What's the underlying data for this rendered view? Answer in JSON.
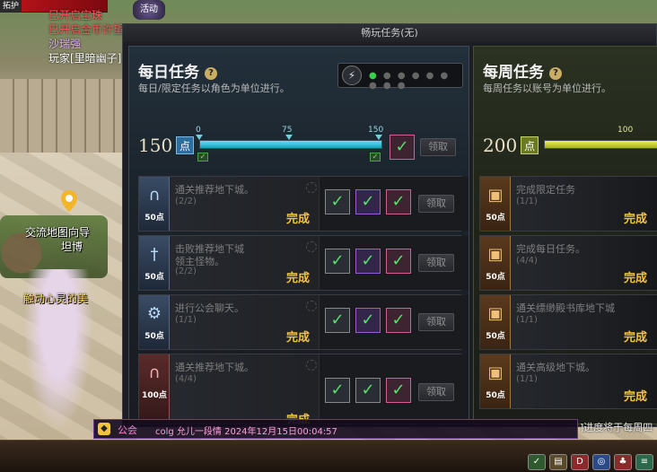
{
  "hud": {
    "level_label": "拓护",
    "activity_label": "活动",
    "lines": [
      "巳开启宝珠",
      "巳开启金币许望",
      "沙瑞强",
      "玩家[里暗幽子]"
    ]
  },
  "npc": {
    "guide": "交流地图向导",
    "guide_name": "坦博",
    "player": "触动心灵的美"
  },
  "panel": {
    "title": "畅玩任务(无)",
    "daily": {
      "heading": "每日任务",
      "subtitle": "每日/限定任务以角色为单位进行。",
      "points": "150",
      "points_unit": "点",
      "ticks": [
        "0",
        "75",
        "150"
      ],
      "progress_fraction": 1.0,
      "claim_label": "领取",
      "tasks": [
        {
          "name": "通关推荐地下城。",
          "progress": "(2/2)",
          "pts": "50点",
          "done": "完成",
          "claim": "领取"
        },
        {
          "name": "击败推荐地下城",
          "name2": "领主怪物。",
          "progress": "(2/2)",
          "pts": "50点",
          "done": "完成",
          "claim": "领取"
        },
        {
          "name": "进行公会聊天。",
          "progress": "(1/1)",
          "pts": "50点",
          "done": "完成",
          "claim": "领取"
        },
        {
          "name": "通关推荐地下城。",
          "progress": "(4/4)",
          "pts": "100点",
          "done": "完成",
          "claim": "领取"
        }
      ]
    },
    "weekly": {
      "heading": "每周任务",
      "subtitle": "每周任务以账号为单位进行。",
      "points": "200",
      "points_unit": "点",
      "ticks": [
        "100"
      ],
      "progress_fraction": 1.0,
      "tasks": [
        {
          "name": "完成限定任务",
          "progress": "(1/1)",
          "pts": "50点",
          "done": "完成"
        },
        {
          "name": "完成每日任务。",
          "progress": "(4/4)",
          "pts": "50点",
          "done": "完成"
        },
        {
          "name": "通关缥缈殿书库地下城",
          "progress": "(1/1)",
          "pts": "50点",
          "done": "完成"
        },
        {
          "name": "通关高级地下城。",
          "progress": "(1/1)",
          "pts": "50点",
          "done": "完成"
        }
      ]
    }
  },
  "chat": {
    "tag": "公会",
    "message": "colg 允儿一段情 2024年12月15日00:04:57",
    "right_text": "]进度将于每周四"
  },
  "colors": {
    "accent_gold": "#f2c43c",
    "daily_fill": "#1a9fbe",
    "weekly_fill": "#a4b018",
    "check_green": "#56e06b"
  }
}
